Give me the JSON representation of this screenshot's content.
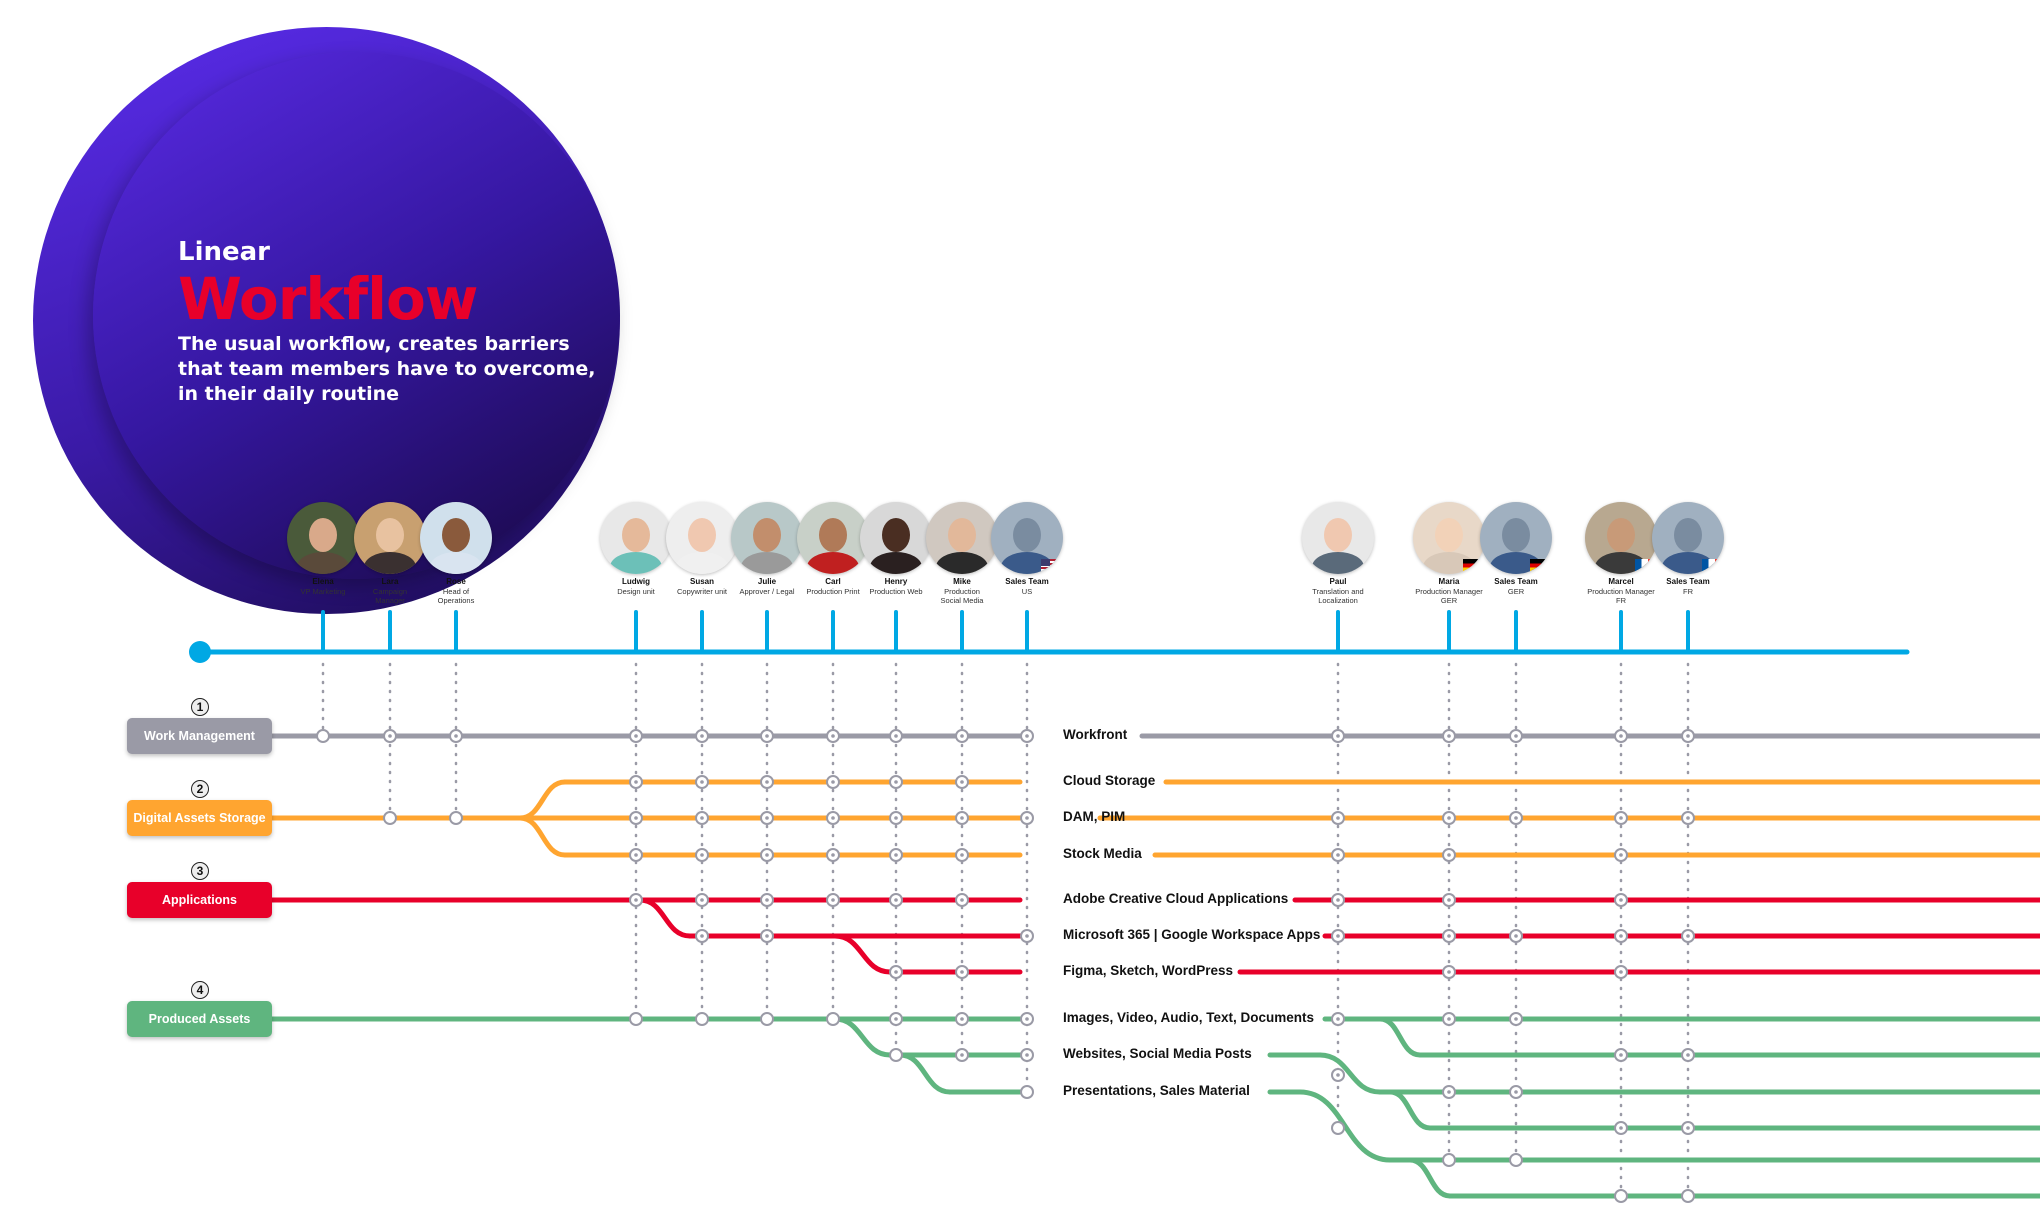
{
  "hero": {
    "kicker": "Linear",
    "title": "Workflow",
    "subtitle": "The usual workflow, creates barriers that team members have to overcome, in their daily routine"
  },
  "colors": {
    "timeline": "#00a8e4",
    "work_management": "#9a9aa6",
    "digital_assets": "#ffa530",
    "applications": "#e8002a",
    "produced_assets": "#5fb57f",
    "hero_title": "#e8002a"
  },
  "people": [
    {
      "name": "Elena",
      "role": "VP Marketing",
      "flag": ""
    },
    {
      "name": "Lara",
      "role": "Campaign\nManager",
      "flag": ""
    },
    {
      "name": "Rose",
      "role": "Head of\nOperations",
      "flag": ""
    },
    {
      "name": "Ludwig",
      "role": "Design unit",
      "flag": ""
    },
    {
      "name": "Susan",
      "role": "Copywriter unit",
      "flag": ""
    },
    {
      "name": "Julie",
      "role": "Approver / Legal",
      "flag": ""
    },
    {
      "name": "Carl",
      "role": "Production Print",
      "flag": ""
    },
    {
      "name": "Henry",
      "role": "Production Web",
      "flag": ""
    },
    {
      "name": "Mike",
      "role": "Production\nSocial Media",
      "flag": ""
    },
    {
      "name": "Sales Team",
      "role": "US",
      "flag": "us"
    },
    {
      "name": "Paul",
      "role": "Translation and\nLocalization",
      "flag": ""
    },
    {
      "name": "Maria",
      "role": "Production Manager\nGER",
      "flag": "de"
    },
    {
      "name": "Sales Team",
      "role": "GER",
      "flag": "de"
    },
    {
      "name": "Marcel",
      "role": "Production Manager\nFR",
      "flag": "fr"
    },
    {
      "name": "Sales Team",
      "role": "FR",
      "flag": "fr"
    }
  ],
  "categories": [
    {
      "number": "1",
      "label": "Work Management",
      "color_key": "work_management"
    },
    {
      "number": "2",
      "label": "Digital Assets Storage",
      "color_key": "digital_assets"
    },
    {
      "number": "3",
      "label": "Applications",
      "color_key": "applications"
    },
    {
      "number": "4",
      "label": "Produced Assets",
      "color_key": "produced_assets"
    }
  ],
  "tools": [
    {
      "label": "Workfront",
      "category": "1"
    },
    {
      "label": "Cloud Storage",
      "category": "2"
    },
    {
      "label": "DAM, PIM",
      "category": "2"
    },
    {
      "label": "Stock Media",
      "category": "2"
    },
    {
      "label": "Adobe Creative Cloud Applications",
      "category": "3"
    },
    {
      "label": "Microsoft 365 | Google Workspace Apps",
      "category": "3"
    },
    {
      "label": "Figma, Sketch, WordPress",
      "category": "3"
    },
    {
      "label": "Images, Video, Audio, Text, Documents",
      "category": "4"
    },
    {
      "label": "Websites, Social Media Posts",
      "category": "4"
    },
    {
      "label": "Presentations, Sales Material",
      "category": "4"
    }
  ]
}
